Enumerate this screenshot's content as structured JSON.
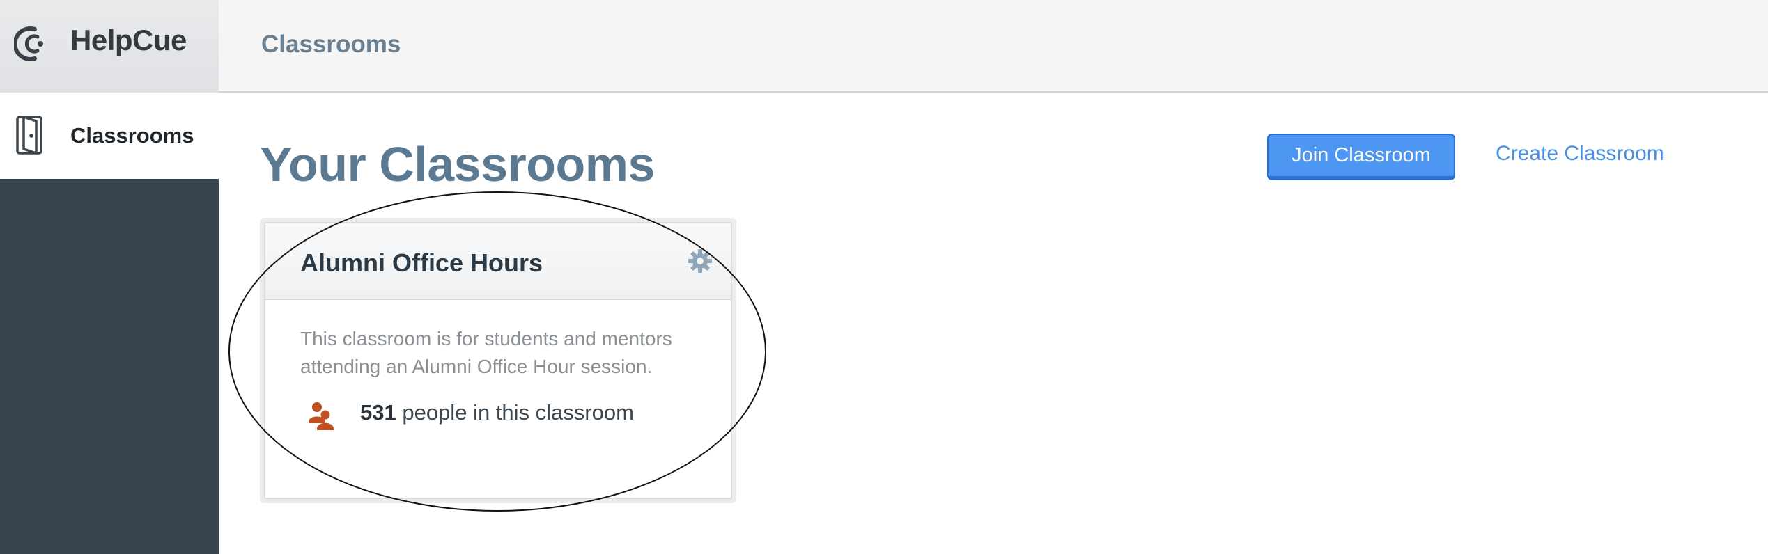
{
  "brand": {
    "name": "HelpCue",
    "logo_icon": "helpcue-logo-icon"
  },
  "sidebar": {
    "items": [
      {
        "label": "Classrooms",
        "icon": "door-icon",
        "active": true
      }
    ]
  },
  "header": {
    "title": "Classrooms"
  },
  "main": {
    "title": "Your Classrooms",
    "join_label": "Join Classroom",
    "create_label": "Create Classroom",
    "classrooms": [
      {
        "name": "Alumni Office Hours",
        "description": "This classroom is for students and mentors attending an Alumni Office Hour session.",
        "people_count": "531",
        "people_suffix": " people in this classroom",
        "settings_icon": "gear-icon",
        "people_icon": "people-icon"
      }
    ]
  },
  "colors": {
    "sidebar_bg": "#36454f",
    "accent_blue": "#4d96f2",
    "link_blue": "#4a90e2",
    "title_slate": "#5b7a92",
    "people_icon": "#c0501f"
  }
}
